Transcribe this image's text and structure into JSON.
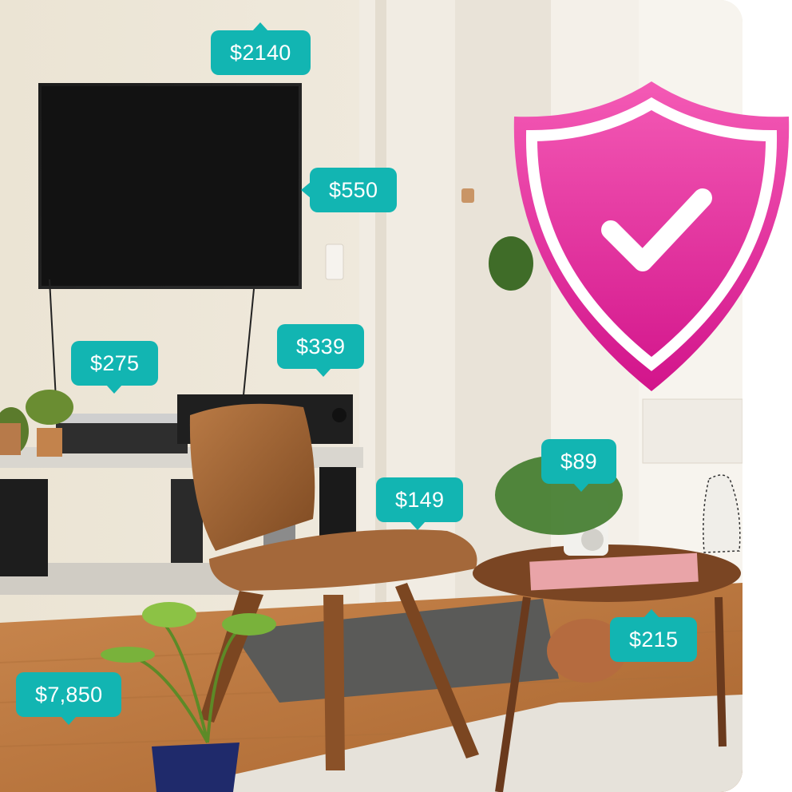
{
  "colors": {
    "tag": "#12b5b2",
    "shield": "#e0249a"
  },
  "icons": [
    "shield-check-icon"
  ],
  "price_tags": {
    "tv_mount": "$2140",
    "tv": "$550",
    "turntable": "$275",
    "receiver": "$339",
    "camera": "$89",
    "chair": "$149",
    "table": "$215",
    "room": "$7,850"
  }
}
